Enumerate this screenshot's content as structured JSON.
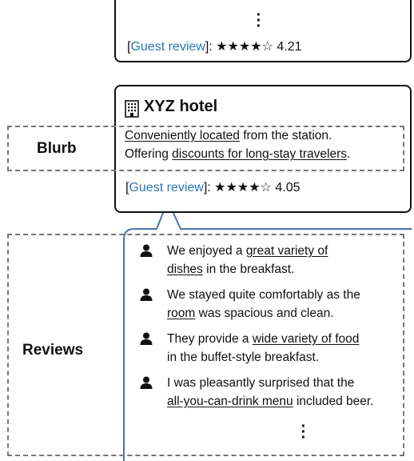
{
  "top_card": {
    "link_text": "Guest review",
    "stars": "★★★★☆",
    "rating": "4.21"
  },
  "hotel_card": {
    "name": "XYZ hotel",
    "icon": "building-icon",
    "blurb": {
      "line1_u": "Conveniently located",
      "line1_rest": " from the station.",
      "line2_pre": "Offering ",
      "line2_u": "discounts for long-stay travelers",
      "line2_post": "."
    },
    "link_text": "Guest review",
    "stars": "★★★★☆",
    "rating": "4.05"
  },
  "labels": {
    "blurb": "Blurb",
    "reviews": "Reviews"
  },
  "reviews": [
    {
      "l1_pre": "We enjoyed a ",
      "l1_u": "great variety of",
      "l1_post": "",
      "l2_u": "dishes",
      "l2_post": " in the breakfast.",
      "l2_pre": ""
    },
    {
      "l1_pre": "We stayed quite comfortably as the",
      "l1_u": "",
      "l1_post": "",
      "l2_pre": "",
      "l2_u": "room",
      "l2_post": " was spacious and clean."
    },
    {
      "l1_pre": "They provide a ",
      "l1_u": "wide variety of food",
      "l1_post": "",
      "l2_pre": "in the buffet-style breakfast.",
      "l2_u": "",
      "l2_post": ""
    },
    {
      "l1_pre": "I was pleasantly surprised that the",
      "l1_u": "",
      "l1_post": "",
      "l2_pre": "",
      "l2_u": "all-you-can-drink menu",
      "l2_post": " included beer."
    }
  ],
  "colors": {
    "link": "#2e75b6",
    "callout": "#4a72b0",
    "dashed": "#777777"
  }
}
